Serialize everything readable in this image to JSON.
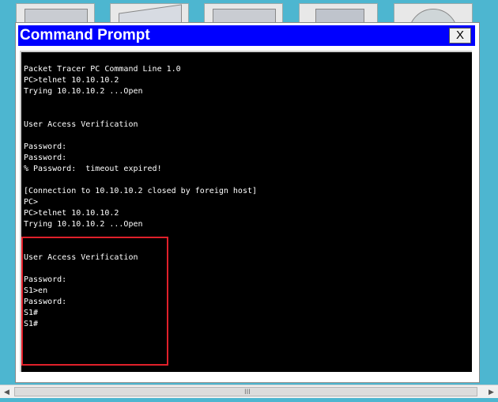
{
  "window": {
    "title": "Command Prompt",
    "close_label": "X"
  },
  "console": {
    "lines": [
      "Packet Tracer PC Command Line 1.0",
      "PC>telnet 10.10.10.2",
      "Trying 10.10.10.2 ...Open",
      "",
      "",
      "User Access Verification",
      "",
      "Password:",
      "Password:",
      "% Password:  timeout expired!",
      "",
      "[Connection to 10.10.10.2 closed by foreign host]",
      "PC>",
      "PC>telnet 10.10.10.2",
      "Trying 10.10.10.2 ...Open",
      "",
      "",
      "User Access Verification",
      "",
      "Password:",
      "S1>en",
      "Password:",
      "S1#",
      "S1#"
    ]
  },
  "scrollbar": {
    "grip": "III"
  }
}
